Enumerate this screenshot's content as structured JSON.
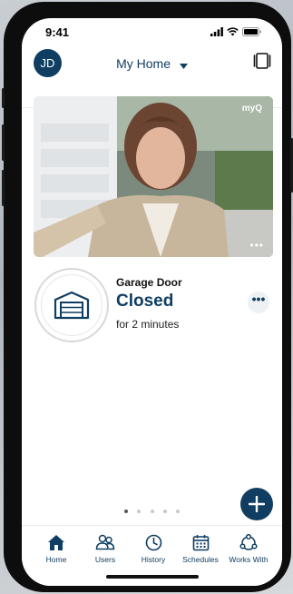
{
  "status_bar": {
    "time": "9:41"
  },
  "header": {
    "avatar_initials": "JD",
    "home_name": "My Home"
  },
  "hero": {
    "brand_logo": "myQ",
    "more_label": "•••"
  },
  "device": {
    "name": "Garage Door",
    "state": "Closed",
    "duration": "for 2 minutes",
    "more_label": "•••"
  },
  "pager": {
    "total": 5,
    "active": 0
  },
  "tabs": [
    {
      "label": "Home",
      "icon": "house-icon"
    },
    {
      "label": "Users",
      "icon": "users-icon"
    },
    {
      "label": "History",
      "icon": "clock-icon"
    },
    {
      "label": "Schedules",
      "icon": "calendar-icon"
    },
    {
      "label": "Works With",
      "icon": "partners-icon"
    }
  ],
  "colors": {
    "brand": "#0f3e62"
  }
}
